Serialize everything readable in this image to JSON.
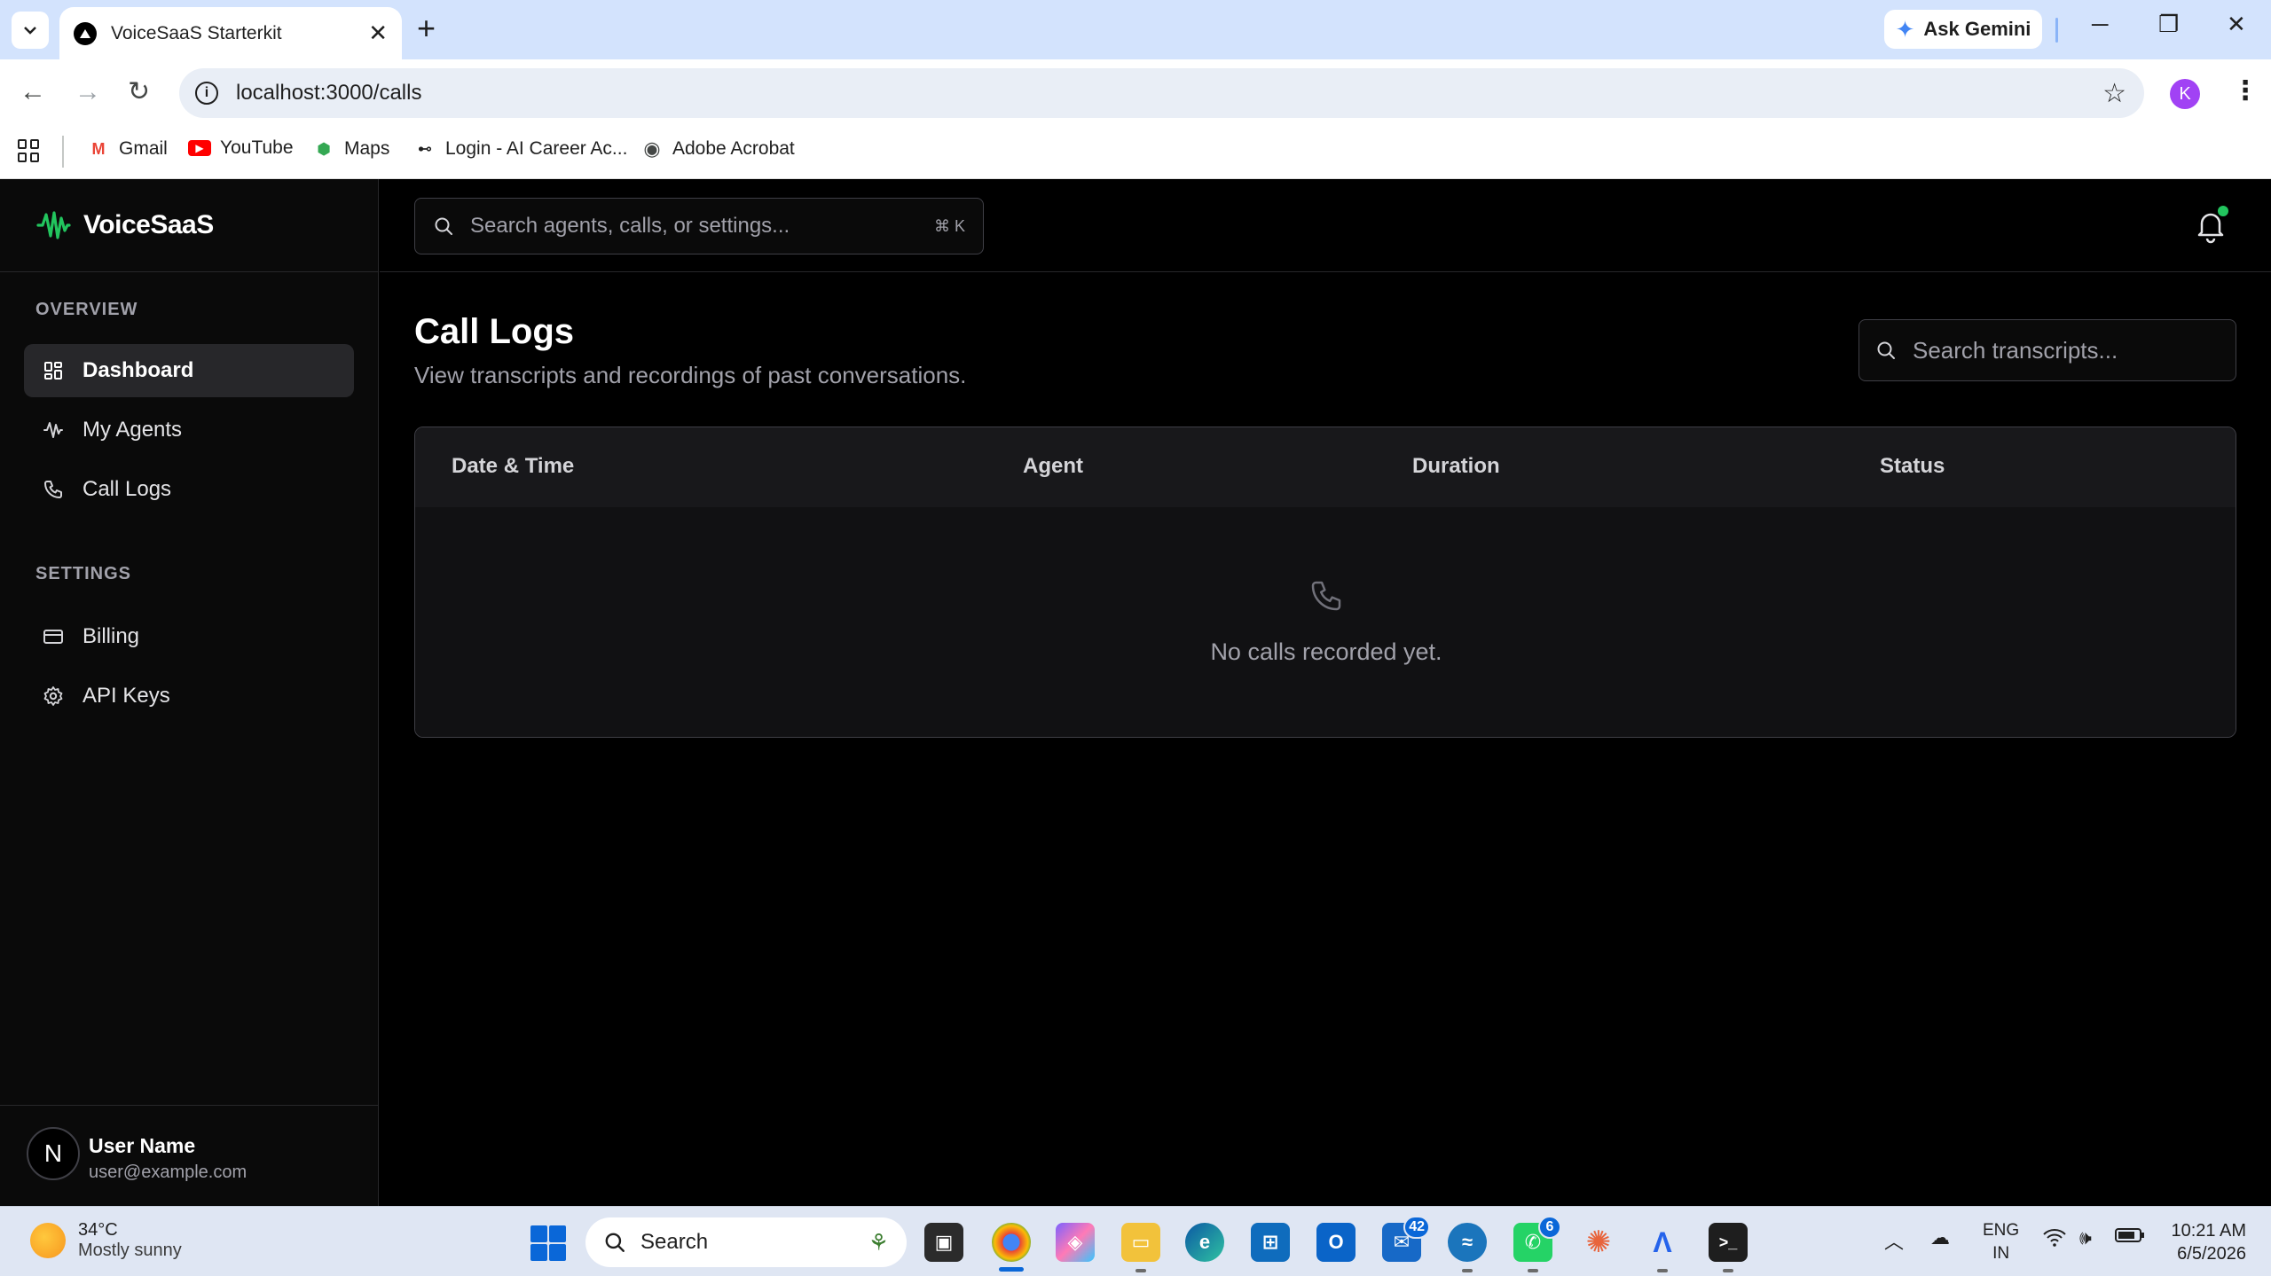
{
  "browser": {
    "tab_title": "VoiceSaaS Starterkit",
    "ask_gemini": "Ask Gemini",
    "url": "localhost:3000/calls",
    "profile_initial": "K",
    "bookmarks": [
      {
        "label": "Gmail",
        "icon": "gmail-icon"
      },
      {
        "label": "YouTube",
        "icon": "youtube-icon"
      },
      {
        "label": "Maps",
        "icon": "maps-icon"
      },
      {
        "label": "Login - AI Career Ac...",
        "icon": "site-icon"
      },
      {
        "label": "Adobe Acrobat",
        "icon": "globe-icon"
      }
    ]
  },
  "app": {
    "brand": "VoiceSaaS",
    "global_search_placeholder": "Search agents, calls, or settings...",
    "global_search_shortcut": "⌘ K",
    "sidebar": {
      "overview_label": "OVERVIEW",
      "overview_items": [
        {
          "label": "Dashboard",
          "icon": "grid-icon",
          "active": true
        },
        {
          "label": "My Agents",
          "icon": "waveform-icon",
          "active": false
        },
        {
          "label": "Call Logs",
          "icon": "phone-icon",
          "active": false
        }
      ],
      "settings_label": "SETTINGS",
      "settings_items": [
        {
          "label": "Billing",
          "icon": "credit-card-icon"
        },
        {
          "label": "API Keys",
          "icon": "gear-icon"
        }
      ]
    },
    "user": {
      "initial": "N",
      "name": "User Name",
      "email": "user@example.com"
    },
    "page": {
      "title": "Call Logs",
      "subtitle": "View transcripts and recordings of past conversations.",
      "transcript_search_placeholder": "Search transcripts...",
      "table_columns": [
        "Date & Time",
        "Agent",
        "Duration",
        "Status"
      ],
      "empty_message": "No calls recorded yet."
    },
    "colors": {
      "accent_green": "#22c55e",
      "background": "#000000",
      "sidebar_bg": "#0a0a0a",
      "active_item_bg": "#27272a"
    }
  },
  "taskbar": {
    "weather_temp": "34°C",
    "weather_desc": "Mostly sunny",
    "search_label": "Search",
    "badges": {
      "mail": "42",
      "whatsapp": "6"
    },
    "lang_line1": "ENG",
    "lang_line2": "IN",
    "time": "10:21 AM",
    "date": "6/5/2026"
  }
}
